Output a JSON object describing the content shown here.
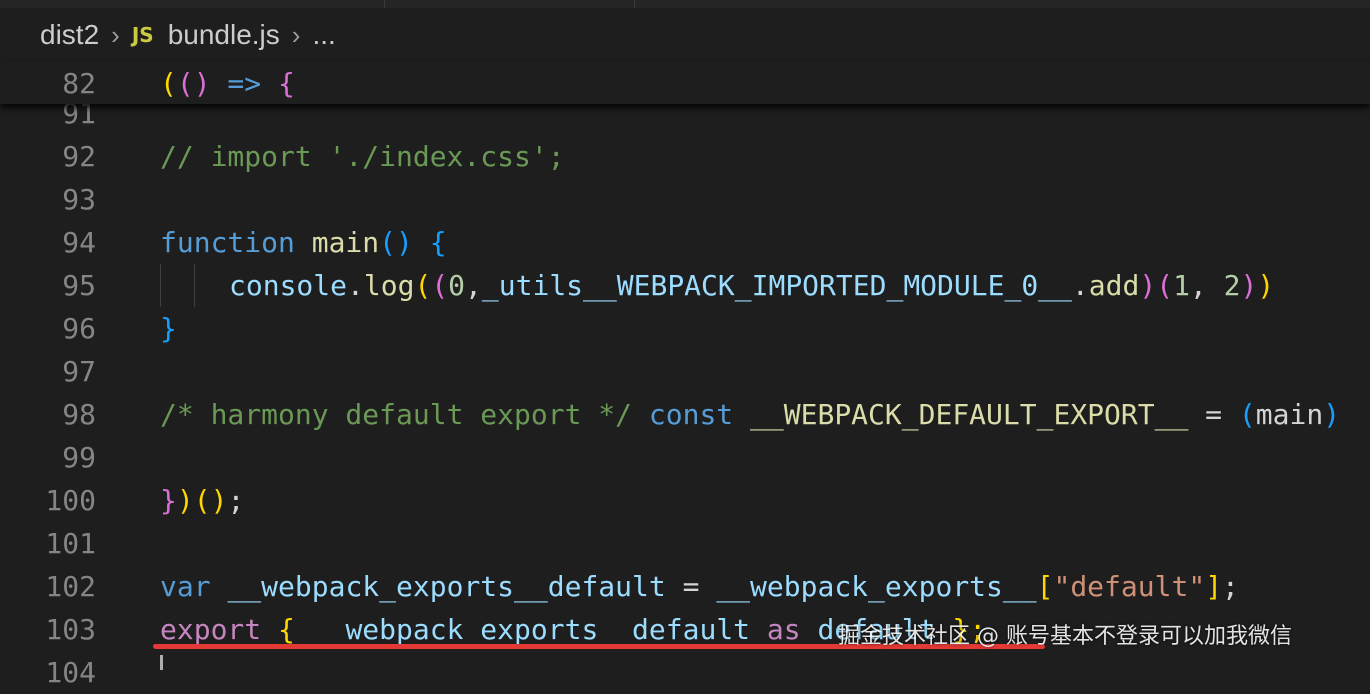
{
  "breadcrumb": {
    "folder": "dist2",
    "file_icon": "JS",
    "file": "bundle.js",
    "ellipsis": "..."
  },
  "sticky": {
    "line": "82",
    "code": "(() => {"
  },
  "lines": {
    "l91": "91",
    "l92": {
      "n": "92",
      "comment": "// import './index.css';"
    },
    "l93": "93",
    "l94": {
      "n": "94",
      "kw": "function",
      "fn": "main",
      "punct": "()",
      "brace": "{"
    },
    "l95": {
      "n": "95",
      "obj": "console",
      "dot": ".",
      "method": "log",
      "p1": "(",
      "p2": "(",
      "zero": "0",
      "comma": ",",
      "mod": "_utils__WEBPACK_IMPORTED_MODULE_0__",
      "dot2": ".",
      "add": "add",
      "p3": ")",
      "p4": "(",
      "one": "1",
      "comma2": ", ",
      "two": "2",
      "p5": ")",
      "p6": ")"
    },
    "l96": {
      "n": "96",
      "brace": "}"
    },
    "l97": "97",
    "l98": {
      "n": "98",
      "comment": "/* harmony default export */",
      "kw": "const",
      "name": "__WEBPACK_DEFAULT_EXPORT__",
      "eq": " = ",
      "paren": "(",
      "main": "main",
      "paren2": ")"
    },
    "l99": "99",
    "l100": {
      "n": "100",
      "b1": "}",
      "b2": ")",
      "b3": "()",
      "semi": ";"
    },
    "l101": "101",
    "l102": {
      "n": "102",
      "kw": "var",
      "name": "__webpack_exports__default",
      "eq": " = ",
      "obj": "__webpack_exports__",
      "open": "[",
      "str": "\"default\"",
      "close": "]",
      "semi": ";"
    },
    "l103": {
      "n": "103",
      "kw": "export",
      "brace": "{",
      "name": "__webpack_exports__default",
      "as": "as",
      "def": "default",
      "brace2": "};"
    },
    "l104": "104"
  },
  "watermark": "掘金技术社区 @ 账号基本不登录可以加我微信",
  "colors": {
    "accent_underline": "#e53935",
    "background": "#1e1e1e"
  }
}
